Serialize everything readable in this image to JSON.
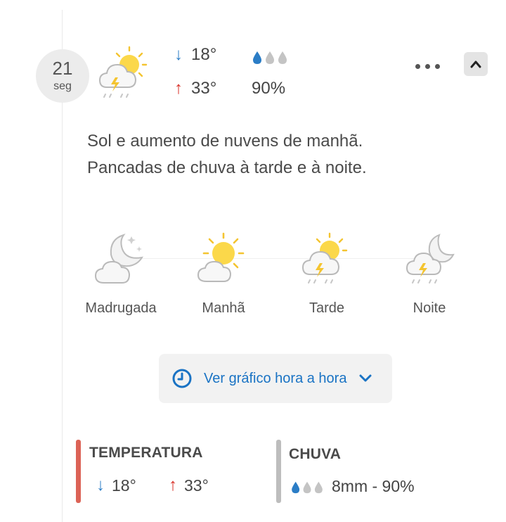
{
  "day": {
    "date": "21",
    "weekday": "seg",
    "min_temp": "18°",
    "max_temp": "33°",
    "precip_prob": "90%",
    "rain_level": 1,
    "icon": "sun-cloud-storm-icon"
  },
  "description": "Sol e aumento de nuvens de manhã. Pancadas de chuva à tarde e à noite.",
  "periods": [
    {
      "label": "Madrugada",
      "icon": "moon-cloud-icon"
    },
    {
      "label": "Manhã",
      "icon": "sun-cloud-icon"
    },
    {
      "label": "Tarde",
      "icon": "sun-cloud-storm-icon"
    },
    {
      "label": "Noite",
      "icon": "moon-cloud-storm-icon"
    }
  ],
  "hourly_button": {
    "label": "Ver gráfico hora a hora"
  },
  "summary": {
    "temperature": {
      "title": "TEMPERATURA",
      "min": "18°",
      "max": "33°"
    },
    "rain": {
      "title": "CHUVA",
      "value": "8mm - 90%"
    }
  },
  "colors": {
    "cold": "#2b7dc6",
    "hot": "#d8322a",
    "accent": "#1a73c4",
    "temp_bar": "#dc6356",
    "rain_bar": "#bdbdbd"
  }
}
